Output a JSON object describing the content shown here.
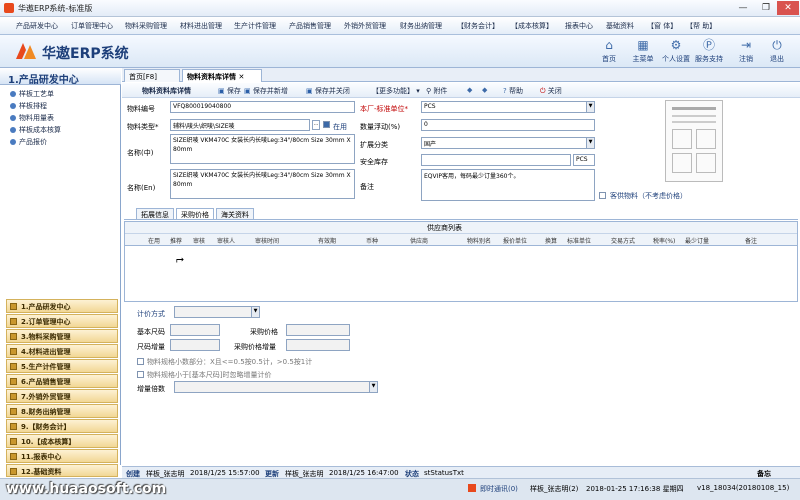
{
  "window": {
    "title": "华遨ERP系统-标准版",
    "controls": [
      "—",
      "❐",
      "✕"
    ]
  },
  "menu": [
    "产品研发中心",
    "订单管理中心",
    "物料采购管理",
    "材料进出管理",
    "生产计件管理",
    "产品销售管理",
    "外销外贸管理",
    "财务出纳管理",
    "【财务会计】",
    "【成本核算】",
    "报表中心",
    "基础资料",
    "【窗 体】",
    "【帮 助】"
  ],
  "banner": {
    "brand": "华遨ERP系统",
    "buttons": [
      {
        "label": "首页",
        "icon": "home-icon",
        "glyph": "⌂"
      },
      {
        "label": "主菜单",
        "icon": "grid-icon",
        "glyph": "▦"
      },
      {
        "label": "个人设置",
        "icon": "gear-icon",
        "glyph": "⚙"
      },
      {
        "label": "服务支持",
        "icon": "support-icon",
        "glyph": "Ⓟ"
      },
      {
        "label": "注销",
        "icon": "logout-icon",
        "glyph": "⇥"
      },
      {
        "label": "退出",
        "icon": "power-icon",
        "glyph": "⏻"
      }
    ]
  },
  "left_panel": {
    "title": "1.产品研发中心",
    "items": [
      "样板工艺单",
      "样板排程",
      "物料用量表",
      "样板成本核算",
      "产品报价"
    ],
    "modules": [
      "1.产品研发中心",
      "2.订单管理中心",
      "3.物料采购管理",
      "4.材料进出管理",
      "5.生产计件管理",
      "6.产品销售管理",
      "7.外销外贸管理",
      "8.财务出纳管理",
      "9.【财务会计】",
      "10.【成本核算】",
      "11.报表中心",
      "12.基础资料"
    ]
  },
  "tabs": [
    "首页[F8]",
    "物料资料库详情"
  ],
  "tab_close": "✕",
  "toolbar": [
    "物料资料库详情",
    "保存",
    "保存并新增",
    "保存并关闭",
    "【更多功能】",
    "附件",
    "帮助",
    "关闭"
  ],
  "form": {
    "code_label": "物料编号",
    "code_value": "VFQ800019040800",
    "type_label": "物料类型*",
    "type_value": "辅料\\唛头\\织唛\\SIZE唛",
    "type_enabled": "在用",
    "name_cn_label": "名称(中)",
    "name_cn_value": "SIZE织唛 VKM470C 女装长内长唛Leg:34\"/80cm Size 30mm X 80mm",
    "name_en_label": "名称(En)",
    "name_en_value": "SIZE织唛 VKM470C 女装长内长唛Leg:34\"/80cm Size 30mm X 80mm",
    "unit_label": "本厂-标准单位*",
    "unit_value": "PCS",
    "float_label": "数量浮动(%)",
    "float_value": "0",
    "category_label": "扩展分类",
    "category_value": "国产",
    "safety_label": "安全库存",
    "safety_unit": "PCS",
    "remark_label": "备注",
    "remark_value": "EQVIP客用，每码最少订量360个。",
    "customer_supply": "客供物料（不考虑价格）"
  },
  "subtabs": [
    "拓展信息",
    "采购价格",
    "海关资料"
  ],
  "grid": {
    "caption": "供应商列表",
    "columns": [
      "在用",
      "推荐",
      "审核",
      "审核人",
      "审核时间",
      "有效期",
      "币种",
      "供应商",
      "物料别名",
      "报价单位",
      "换算",
      "标准单位",
      "交易方式",
      "税率(%)",
      "最少订量",
      "备注"
    ]
  },
  "pricing": {
    "method_label": "计价方式",
    "base_size": "基本尺码",
    "purchase_price": "采购价格",
    "size_increment": "尺码增量",
    "price_increment": "采购价格增量",
    "opt1": "物料规格小数部分：X且<=0.5按0.5计，>0.5按1计",
    "opt2": "物料规格小于[基本尺码]时忽略增量计价",
    "multiplier_label": "增量倍数"
  },
  "status": {
    "created_label": "创建",
    "created_by": "样板_张志明",
    "created_time": "2018/1/25 15:57:00",
    "updated_label": "更新",
    "updated_by": "样板_张志明",
    "updated_time": "2018/1/25 16:47:00",
    "state_label": "状态",
    "state_value": "stStatusTxt",
    "memo": "备忘"
  },
  "taskbar": {
    "site": "www.huaaosoft.com",
    "msg": "即时通讯(0)",
    "user": "样板_张志明(2)",
    "datetime": "2018-01-25  17:16:38 星期四",
    "version": "v18_18034(20180108_15)"
  }
}
